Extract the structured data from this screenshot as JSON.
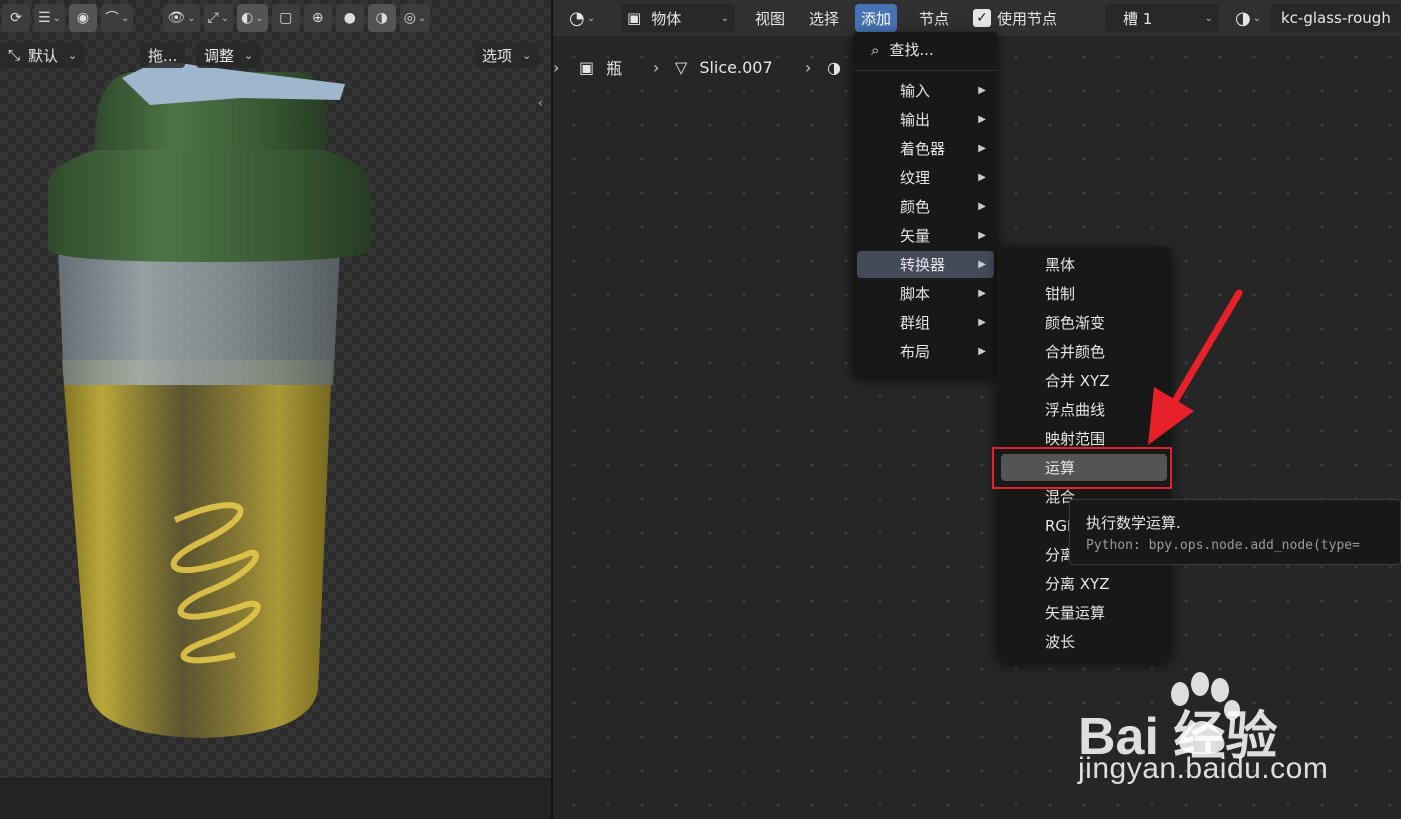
{
  "viewport": {
    "header2": {
      "mode_label": "默认",
      "drag_label": "拖...",
      "adjust_label": "调整",
      "options_label": "选项"
    }
  },
  "node_editor": {
    "header": {
      "object_label": "物体",
      "view_label": "视图",
      "select_label": "选择",
      "add_label": "添加",
      "node_label": "节点",
      "use_nodes_label": "使用节点",
      "use_nodes_checked": true,
      "slot_label": "槽 1",
      "material_name": "kc-glass-rough"
    },
    "breadcrumb": {
      "object": "瓶",
      "mesh": "Slice.007",
      "material": "kc-glass-rough"
    }
  },
  "add_menu": {
    "search_label": "查找...",
    "items": [
      {
        "label": "输入"
      },
      {
        "label": "输出"
      },
      {
        "label": "着色器"
      },
      {
        "label": "纹理"
      },
      {
        "label": "颜色"
      },
      {
        "label": "矢量"
      },
      {
        "label": "转换器"
      },
      {
        "label": "脚本"
      },
      {
        "label": "群组"
      },
      {
        "label": "布局"
      }
    ],
    "active_item": "转换器"
  },
  "converter_submenu": {
    "items": [
      {
        "label": "黑体"
      },
      {
        "label": "钳制"
      },
      {
        "label": "颜色渐变"
      },
      {
        "label": "合并颜色"
      },
      {
        "label": "合并 XYZ"
      },
      {
        "label": "浮点曲线"
      },
      {
        "label": "映射范围"
      },
      {
        "label": "运算"
      },
      {
        "label": "混合"
      },
      {
        "label": "RGB 到 BW"
      },
      {
        "label": "分离颜色"
      },
      {
        "label": "分离 XYZ"
      },
      {
        "label": "矢量运算"
      },
      {
        "label": "波长"
      }
    ],
    "highlighted_item": "运算"
  },
  "tooltip": {
    "description": "执行数学运算.",
    "python": "Python: bpy.ops.node.add_node(type="
  },
  "watermark": {
    "brand": "Bai 经验",
    "url": "jingyan.baidu.com"
  },
  "colors": {
    "menu_open": "#4772b3",
    "highlight_border": "#e0242c",
    "arrow": "#e8202a"
  }
}
